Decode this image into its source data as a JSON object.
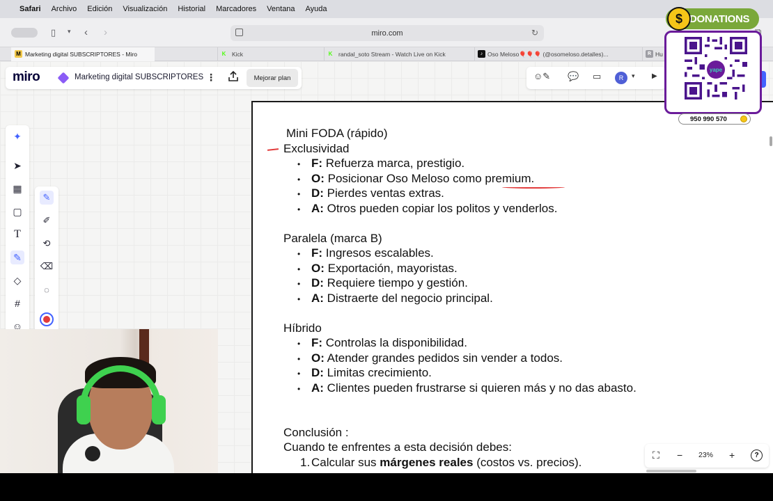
{
  "menubar": {
    "app": "Safari",
    "items": [
      "Archivo",
      "Edición",
      "Visualización",
      "Historial",
      "Marcadores",
      "Ventana",
      "Ayuda"
    ]
  },
  "browser": {
    "url": "miro.com",
    "tabs": [
      {
        "label": "Marketing digital SUBSCRIPTORES - Miro",
        "favicon": "M",
        "active": true
      },
      {
        "label": "Kick",
        "favicon": "K"
      },
      {
        "label": "randal_soto Stream - Watch Live on Kick",
        "favicon": "K"
      },
      {
        "label": "Oso Meloso🎈🎈🎈 (@osomeloso.detalles)...",
        "favicon": "tiktok"
      },
      {
        "label": "Hu",
        "favicon": "R"
      }
    ]
  },
  "miro": {
    "logo": "miro",
    "board_title": "Marketing digital SUBSCRIPTORES",
    "upgrade_label": "Mejorar plan",
    "avatar_initial": "R",
    "zoom_level": "23%"
  },
  "document": {
    "title": "Mini FODA (rápido)",
    "sections": [
      {
        "heading": "Exclusividad",
        "items": [
          {
            "key": "F:",
            "text": " Refuerza marca, prestigio."
          },
          {
            "key": "O:",
            "text": " Posicionar Oso Meloso como premium."
          },
          {
            "key": "D:",
            "text": " Pierdes ventas extras."
          },
          {
            "key": "A:",
            "text": " Otros pueden copiar los politos y venderlos."
          }
        ]
      },
      {
        "heading": "Paralela (marca B)",
        "items": [
          {
            "key": "F:",
            "text": " Ingresos escalables."
          },
          {
            "key": "O:",
            "text": " Exportación, mayoristas."
          },
          {
            "key": "D:",
            "text": " Requiere tiempo y gestión."
          },
          {
            "key": "A:",
            "text": " Distraerte del negocio principal."
          }
        ]
      },
      {
        "heading": "Híbrido",
        "items": [
          {
            "key": "F:",
            "text": " Controlas la disponibilidad."
          },
          {
            "key": "O:",
            "text": " Atender grandes pedidos sin vender a todos."
          },
          {
            "key": "D:",
            "text": " Limitas crecimiento."
          },
          {
            "key": "A:",
            "text": " Clientes pueden frustrarse si quieren más y no das abasto."
          }
        ]
      }
    ],
    "conclusion_heading": "Conclusión :",
    "conclusion_intro": "Cuando te enfrentes a esta decisión debes:",
    "conclusion_items": [
      {
        "num": "1.",
        "pre": "Calcular sus ",
        "bold": "márgenes reales",
        "post": " (costos vs. precios)."
      }
    ]
  },
  "donations": {
    "banner": "DONATIONS",
    "coin_symbol": "$",
    "qr_logo": "yape",
    "phone": "950 990 570"
  },
  "colors": {
    "miro_accent": "#4262ff",
    "annotation_red": "#e23b3b",
    "donations_green": "#7aa83a",
    "qr_purple": "#6a1b9a"
  }
}
